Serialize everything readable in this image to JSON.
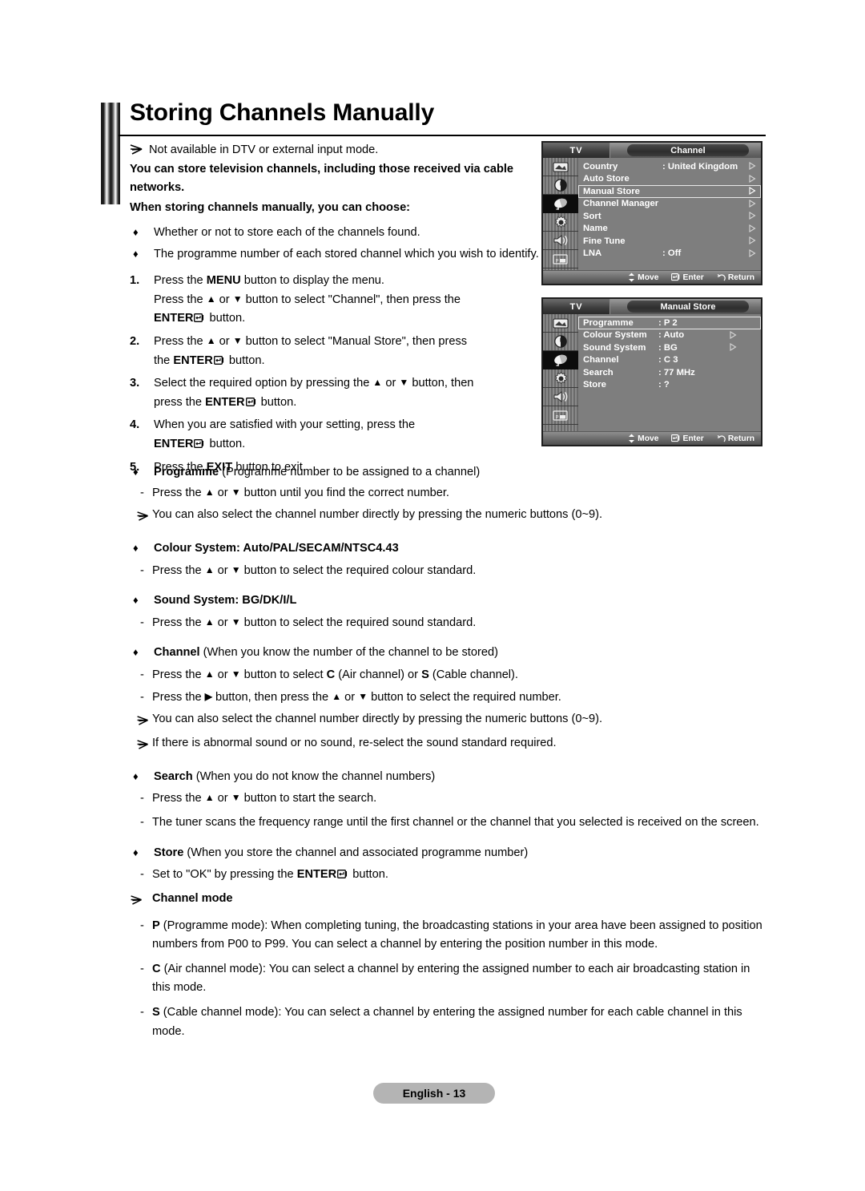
{
  "page": {
    "title": "Storing Channels Manually",
    "footer_label": "English - 13"
  },
  "intro": {
    "note": "Not available in DTV or external input mode.",
    "bold_para_1": "You can store television channels, including those received via cable networks.",
    "bold_para_2": "When storing channels manually, you can choose:",
    "bullets": [
      "Whether or not to store each of the channels found.",
      "The programme number of each stored channel which you wish to identify."
    ]
  },
  "steps": [
    {
      "num": "1.",
      "line_1_a": "Press the ",
      "line_1_b": "MENU",
      "line_1_c": " button to display the menu.",
      "line_2_a": "Press the ",
      "line_2_b": "▲",
      "line_2_c": " or ",
      "line_2_d": "▼",
      "line_2_e": " button to select \"Channel\", then press the ",
      "line_3_b": "ENTER",
      "line_3_c": " button."
    },
    {
      "num": "2.",
      "line_1_a": "Press the ",
      "line_1_b": "▲",
      "line_1_c": " or ",
      "line_1_d": "▼",
      "line_1_e": " button to select \"Manual Store\", then press",
      "line_2_a": "the ",
      "line_2_b": "ENTER",
      "line_2_c": " button."
    },
    {
      "num": "3.",
      "line_1_a": "Select the required option by pressing the ",
      "line_1_b": "▲",
      "line_1_c": " or ",
      "line_1_d": "▼",
      "line_1_e": " button, then",
      "line_2_a": "press the ",
      "line_2_b": "ENTER",
      "line_2_c": " button."
    },
    {
      "num": "4.",
      "line_1_a": "When you are satisfied with your setting, press the",
      "line_2_b": "ENTER",
      "line_2_c": " button."
    },
    {
      "num": "5.",
      "line_1_a": "Press the ",
      "line_1_b": "EXIT",
      "line_1_c": " button to exit."
    }
  ],
  "options": [
    {
      "bullet": "♦",
      "heading_bold": "Programme",
      "heading_rest": " (Programme number to be assigned to a channel)",
      "children": [
        {
          "kind": "dash",
          "a": "Press the ",
          "tri1": "▲",
          "b": " or ",
          "tri2": "▼",
          "c": " button until you find the correct number."
        },
        {
          "kind": "arrow",
          "a": "You can also select the channel number directly by pressing the numeric buttons (0~9)."
        }
      ]
    },
    {
      "bullet": "♦",
      "heading_bold": "Colour System: Auto/PAL/SECAM/NTSC4.43",
      "heading_rest": "",
      "children": [
        {
          "kind": "dash",
          "a": "Press the ",
          "tri1": "▲",
          "b": " or ",
          "tri2": "▼",
          "c": " button to select the required colour standard."
        }
      ]
    },
    {
      "bullet": "♦",
      "heading_bold": "Sound System: BG/DK/I/L",
      "heading_rest": "",
      "children": [
        {
          "kind": "dash",
          "a": "Press the ",
          "tri1": "▲",
          "b": " or ",
          "tri2": "▼",
          "c": " button to select the required sound standard."
        }
      ]
    },
    {
      "bullet": "♦",
      "heading_bold": "Channel",
      "heading_rest": " (When you know the number of the channel to be stored)",
      "children": [
        {
          "kind": "dash-cs",
          "a": "Press the ",
          "tri1": "▲",
          "b": " or ",
          "tri2": "▼",
          "c": " button to select ",
          "bold1": "C",
          "d": " (Air channel) or ",
          "bold2": "S",
          "e": " (Cable channel)."
        },
        {
          "kind": "dash-right",
          "a": "Press the ",
          "tri1": "▶",
          "b": " button, then press the ",
          "tri2": "▲",
          "c": " or ",
          "tri3": "▼",
          "d": " button to select the required number."
        },
        {
          "kind": "arrow",
          "a": "You can also select the channel number directly by pressing the numeric buttons (0~9)."
        },
        {
          "kind": "arrow",
          "a": "If there is abnormal sound or no sound, re-select the sound standard required."
        }
      ]
    },
    {
      "bullet": "♦",
      "heading_bold": "Search",
      "heading_rest": " (When you do not know the channel numbers)",
      "children": [
        {
          "kind": "dash",
          "a": "Press the ",
          "tri1": "▲",
          "b": " or ",
          "tri2": "▼",
          "c": " button to start the search."
        },
        {
          "kind": "plain",
          "a": "The tuner scans the frequency range until the first channel or the channel that you selected is received on the screen."
        }
      ]
    },
    {
      "bullet": "♦",
      "heading_bold": "Store",
      "heading_rest": " (When you store the channel and associated programme number)",
      "children": [
        {
          "kind": "dash-enter",
          "a": "Set to \"OK\" by pressing the ",
          "bold1": "ENTER",
          "c": " button."
        }
      ]
    }
  ],
  "channel_mode": {
    "heading": "Channel mode",
    "items": [
      {
        "bold": "P",
        "text": " (Programme mode): When completing tuning, the broadcasting stations in your area have been assigned to position numbers from P00 to P99. You can select a channel by entering the position number in this mode."
      },
      {
        "bold": "C",
        "text": " (Air channel mode): You can select a channel by entering the assigned number to each air broadcasting station in this mode."
      },
      {
        "bold": "S",
        "text": " (Cable channel mode): You can select a channel by entering the assigned number for each cable channel in this mode."
      }
    ]
  },
  "osd_channel": {
    "tv_tag": "TV",
    "title": "Channel",
    "rows": [
      {
        "label": "Country",
        "value": ": United Kingdom",
        "arrow": true,
        "highlight": false
      },
      {
        "label": "Auto Store",
        "value": "",
        "arrow": true,
        "highlight": false
      },
      {
        "label": "Manual Store",
        "value": "",
        "arrow": true,
        "highlight": true
      },
      {
        "label": "Channel Manager",
        "value": "",
        "arrow": true,
        "highlight": false
      },
      {
        "label": "Sort",
        "value": "",
        "arrow": true,
        "highlight": false
      },
      {
        "label": "Name",
        "value": "",
        "arrow": true,
        "highlight": false
      },
      {
        "label": "Fine Tune",
        "value": "",
        "arrow": true,
        "highlight": false
      },
      {
        "label": "LNA",
        "value": ": Off",
        "arrow": true,
        "highlight": false
      }
    ],
    "footer": {
      "move": "Move",
      "enter": "Enter",
      "return": "Return"
    }
  },
  "osd_manual_store": {
    "tv_tag": "TV",
    "title": "Manual Store",
    "rows": [
      {
        "label": "Programme",
        "value": ": P 2",
        "arrow": false,
        "highlight": true
      },
      {
        "label": "Colour System",
        "value": ": Auto",
        "arrow": true,
        "highlight": false
      },
      {
        "label": "Sound System",
        "value": ": BG",
        "arrow": true,
        "highlight": false
      },
      {
        "label": "Channel",
        "value": ": C 3",
        "arrow": false,
        "highlight": false
      },
      {
        "label": "Search",
        "value": ": 77 MHz",
        "arrow": false,
        "highlight": false
      },
      {
        "label": "Store",
        "value": ": ?",
        "arrow": false,
        "highlight": false
      }
    ],
    "footer": {
      "move": "Move",
      "enter": "Enter",
      "return": "Return"
    }
  },
  "icons": {
    "sidebar": [
      "picture-icon",
      "clock-icon",
      "channel-dish-icon",
      "setup-gear-icon",
      "sound-icon",
      "pip-icon"
    ],
    "note_arrow": "note-arrow-icon",
    "enter_glyph": "enter-return-icon",
    "move_glyph": "up-down-arrows-icon",
    "return_glyph": "return-curve-icon"
  },
  "colors": {
    "osd_background": "#7e7e7e",
    "osd_border": "#1e1e1e",
    "osd_selected": "#0c0c0c",
    "footer_badge": "#b4b4b4",
    "text": "#000000"
  }
}
